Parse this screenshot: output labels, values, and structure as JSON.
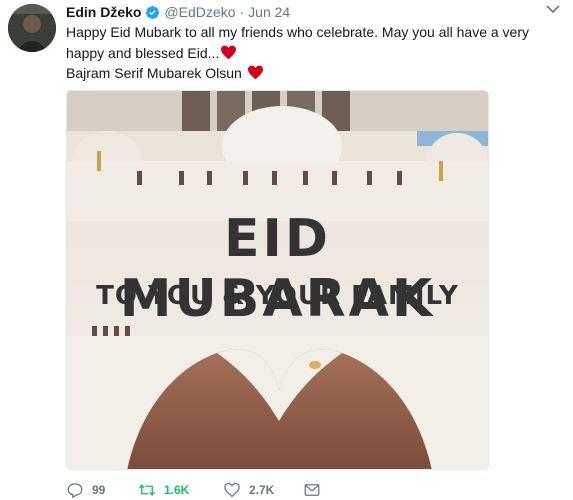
{
  "author": {
    "name": "Edin Džeko",
    "handle": "@EdDzeko",
    "separator": "·",
    "date": "Jun 24"
  },
  "tweet": {
    "line1": "Happy Eid Mubark to all my friends who celebrate. May you all have a very",
    "line2": "happy and blessed Eid...",
    "line3": "Bajram Serif Mubarek Olsun"
  },
  "media": {
    "title": "EID MUBARAK",
    "subtitle": "TO YOU & YOUR FAMILY"
  },
  "actions": {
    "replies": "99",
    "retweets": "1.6K",
    "likes": "2.7K"
  },
  "icons": {
    "verified": "verified-badge-icon",
    "caret": "chevron-down-icon",
    "heart_emoji": "red-heart-icon",
    "reply": "reply-icon",
    "retweet": "retweet-icon",
    "like": "like-icon",
    "dm": "direct-message-icon"
  },
  "colors": {
    "verified": "#1da1f2",
    "retweet_active": "#17bf63",
    "emoji_heart": "#d0021b",
    "muted": "#657786"
  }
}
